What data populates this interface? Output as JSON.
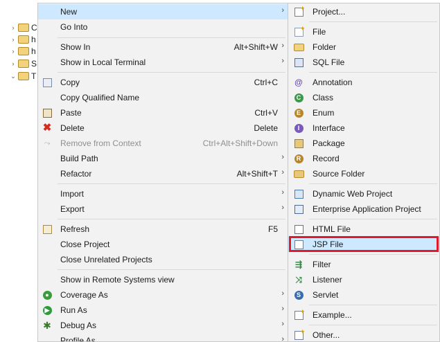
{
  "explorer": {
    "rows": [
      {
        "arrow": "›",
        "label": "C"
      },
      {
        "arrow": "›",
        "label": "h"
      },
      {
        "arrow": "›",
        "label": "h"
      },
      {
        "arrow": "›",
        "label": "S"
      },
      {
        "arrow": "⌄",
        "label": "T"
      }
    ]
  },
  "context_menu": {
    "items": [
      {
        "label": "New",
        "shortcut": "",
        "submenu": true,
        "icon": "none",
        "highlighted": true
      },
      {
        "label": "Go Into",
        "shortcut": "",
        "submenu": false,
        "icon": "none"
      },
      {
        "label": "Show In",
        "shortcut": "Alt+Shift+W",
        "submenu": true,
        "icon": "none"
      },
      {
        "label": "Show in Local Terminal",
        "shortcut": "",
        "submenu": true,
        "icon": "none"
      },
      {
        "label": "Copy",
        "shortcut": "Ctrl+C",
        "submenu": false,
        "icon": "copy-icon"
      },
      {
        "label": "Copy Qualified Name",
        "shortcut": "",
        "submenu": false,
        "icon": "copy-qualified-icon"
      },
      {
        "label": "Paste",
        "shortcut": "Ctrl+V",
        "submenu": false,
        "icon": "paste-icon"
      },
      {
        "label": "Delete",
        "shortcut": "Delete",
        "submenu": false,
        "icon": "delete-icon"
      },
      {
        "label": "Remove from Context",
        "shortcut": "Ctrl+Alt+Shift+Down",
        "submenu": false,
        "icon": "remove-context-icon",
        "disabled": true
      },
      {
        "label": "Build Path",
        "shortcut": "",
        "submenu": true,
        "icon": "none"
      },
      {
        "label": "Refactor",
        "shortcut": "Alt+Shift+T",
        "submenu": true,
        "icon": "none"
      },
      {
        "label": "Import",
        "shortcut": "",
        "submenu": true,
        "icon": "none"
      },
      {
        "label": "Export",
        "shortcut": "",
        "submenu": true,
        "icon": "none"
      },
      {
        "label": "Refresh",
        "shortcut": "F5",
        "submenu": false,
        "icon": "refresh-icon"
      },
      {
        "label": "Close Project",
        "shortcut": "",
        "submenu": false,
        "icon": "none"
      },
      {
        "label": "Close Unrelated Projects",
        "shortcut": "",
        "submenu": false,
        "icon": "none"
      },
      {
        "label": "Show in Remote Systems view",
        "shortcut": "",
        "submenu": false,
        "icon": "none"
      },
      {
        "label": "Coverage As",
        "shortcut": "",
        "submenu": true,
        "icon": "coverage-icon"
      },
      {
        "label": "Run As",
        "shortcut": "",
        "submenu": true,
        "icon": "run-icon"
      },
      {
        "label": "Debug As",
        "shortcut": "",
        "submenu": true,
        "icon": "debug-icon"
      },
      {
        "label": "Profile As",
        "shortcut": "",
        "submenu": true,
        "icon": "none"
      }
    ]
  },
  "new_submenu": {
    "items": [
      {
        "label": "Project...",
        "icon": "project-icon"
      },
      {
        "label": "File",
        "icon": "file-icon"
      },
      {
        "label": "Folder",
        "icon": "folder-icon"
      },
      {
        "label": "SQL File",
        "icon": "sql-file-icon"
      },
      {
        "label": "Annotation",
        "icon": "annotation-icon"
      },
      {
        "label": "Class",
        "icon": "class-icon"
      },
      {
        "label": "Enum",
        "icon": "enum-icon"
      },
      {
        "label": "Interface",
        "icon": "interface-icon"
      },
      {
        "label": "Package",
        "icon": "package-icon"
      },
      {
        "label": "Record",
        "icon": "record-icon"
      },
      {
        "label": "Source Folder",
        "icon": "source-folder-icon"
      },
      {
        "label": "Dynamic Web Project",
        "icon": "dynamic-web-project-icon"
      },
      {
        "label": "Enterprise Application Project",
        "icon": "enterprise-app-project-icon"
      },
      {
        "label": "HTML File",
        "icon": "html-file-icon"
      },
      {
        "label": "JSP File",
        "icon": "jsp-file-icon",
        "selected": true
      },
      {
        "label": "Filter",
        "icon": "filter-icon"
      },
      {
        "label": "Listener",
        "icon": "listener-icon"
      },
      {
        "label": "Servlet",
        "icon": "servlet-icon"
      },
      {
        "label": "Example...",
        "icon": "example-icon"
      },
      {
        "label": "Other...",
        "icon": "other-icon"
      }
    ]
  },
  "colors": {
    "menu_bg": "#f2f2f2",
    "hover_bg": "#cde8ff",
    "highlight_border": "#e0192b"
  }
}
